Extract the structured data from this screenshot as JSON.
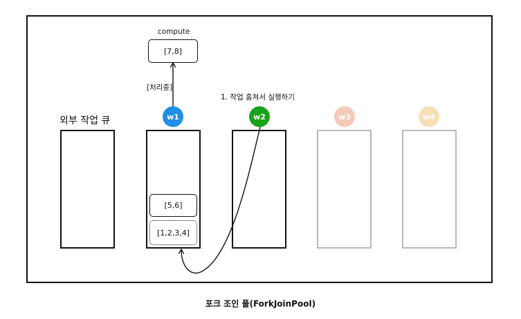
{
  "external_queue_label": "외부 작업 큐",
  "compute": {
    "label": "compute",
    "task": "[7,8]",
    "status": "[처리중]"
  },
  "workers": [
    {
      "id": "w1",
      "color": "#1e8ee6",
      "text_color": "#ffffff",
      "active": true
    },
    {
      "id": "w2",
      "color": "#19a319",
      "text_color": "#ffffff",
      "active": true
    },
    {
      "id": "w3",
      "color": "#f6c9b8",
      "text_color": "#ffffff",
      "active": false
    },
    {
      "id": "w4",
      "color": "#f8dfb5",
      "text_color": "#ffffff",
      "active": false
    }
  ],
  "w1_tasks": [
    "[5,6]",
    "[1,2,3,4]"
  ],
  "steal_label": "1. 작업 훔쳐서 실행하기",
  "caption": "포크 조인 풀(ForkJoinPool)"
}
